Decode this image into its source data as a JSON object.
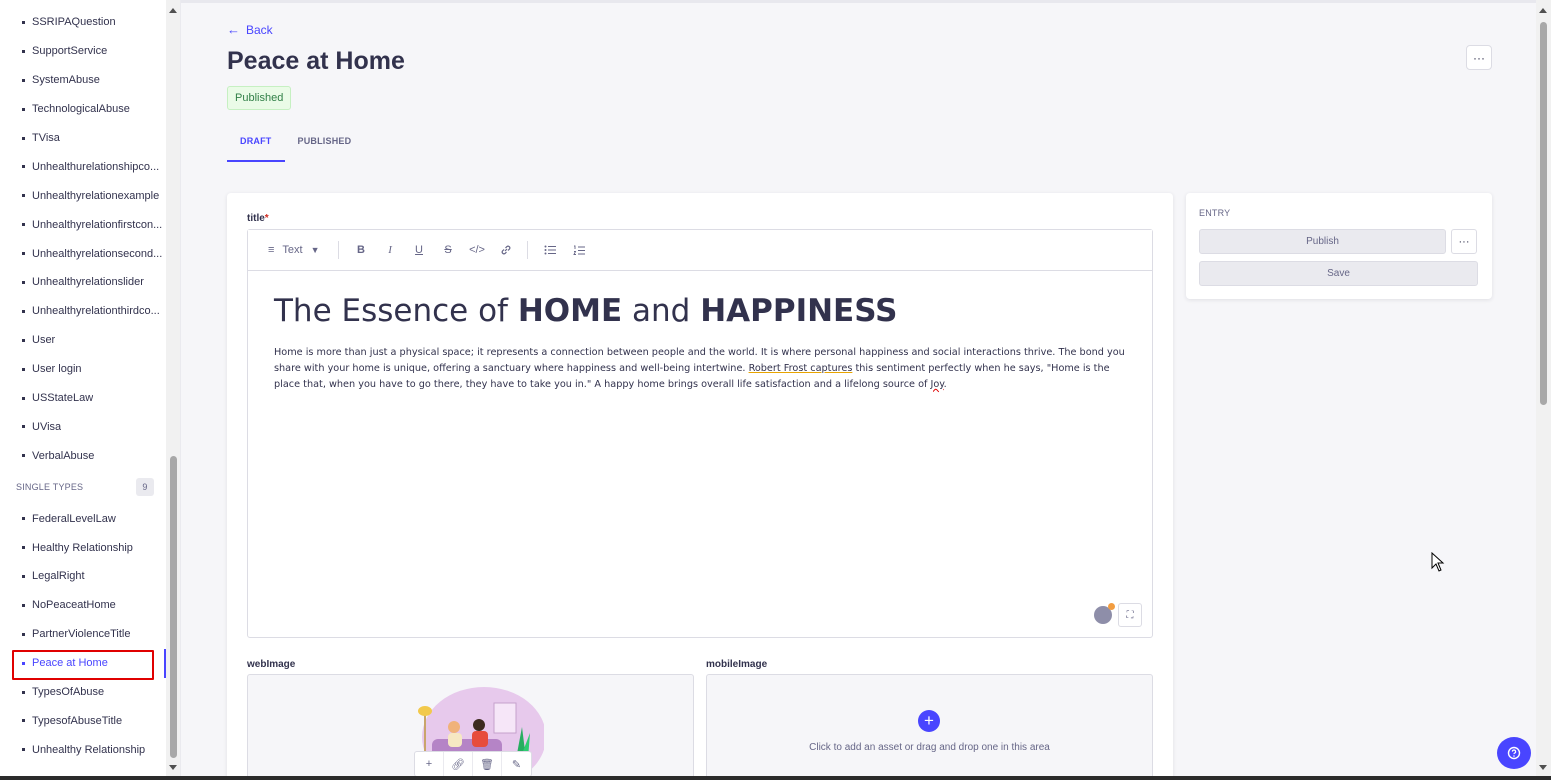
{
  "sidebar": {
    "collection_items": [
      {
        "label": "SSRIPAQuestion"
      },
      {
        "label": "SupportService"
      },
      {
        "label": "SystemAbuse"
      },
      {
        "label": "TechnologicalAbuse"
      },
      {
        "label": "TVisa"
      },
      {
        "label": "Unhealthurelationshipco..."
      },
      {
        "label": "Unhealthyrelationexample"
      },
      {
        "label": "Unhealthyrelationfirstcon..."
      },
      {
        "label": "Unhealthyrelationsecond..."
      },
      {
        "label": "Unhealthyrelationslider"
      },
      {
        "label": "Unhealthyrelationthirdco..."
      },
      {
        "label": "User"
      },
      {
        "label": "User login"
      },
      {
        "label": "USStateLaw"
      },
      {
        "label": "UVisa"
      },
      {
        "label": "VerbalAbuse"
      }
    ],
    "single_types_label": "SINGLE TYPES",
    "single_types_count": "9",
    "single_items": [
      {
        "label": "FederalLevelLaw"
      },
      {
        "label": "Healthy Relationship"
      },
      {
        "label": "LegalRight"
      },
      {
        "label": "NoPeaceatHome"
      },
      {
        "label": "PartnerViolenceTitle"
      },
      {
        "label": "Peace at Home",
        "active": true
      },
      {
        "label": "TypesOfAbuse"
      },
      {
        "label": "TypesofAbuseTitle"
      },
      {
        "label": "Unhealthy Relationship"
      }
    ]
  },
  "header": {
    "back_label": "Back",
    "title": "Peace at Home",
    "status": "Published",
    "more": "···"
  },
  "tabs": [
    {
      "label": "DRAFT",
      "active": true
    },
    {
      "label": "PUBLISHED",
      "active": false
    }
  ],
  "form": {
    "title_label": "title",
    "required_mark": "*",
    "toolbar": {
      "block_type": "Text",
      "buttons": [
        "B",
        "I",
        "U",
        "S",
        "</>",
        "link",
        "bullet-list",
        "numbered-list"
      ]
    },
    "heading": {
      "part1": "The Essence of ",
      "bold1": "HOME",
      "part2": " and ",
      "bold2": "HAPPINESS"
    },
    "paragraph": {
      "text1": "Home is more than just a physical space; it represents a connection between people and the world. It is where personal happiness and social interactions thrive. The bond you share with your home is unique, offering a sanctuary where happiness and well-being intertwine. ",
      "underlined": "Robert Frost captures",
      "text2": " this sentiment perfectly when he says, \"Home is the place that, when you have to go there, they have to take you in.\" A happy home brings overall life satisfaction and a lifelong source of ",
      "misspelled": "Joy",
      "text3": "."
    },
    "web_image_label": "webImage",
    "mobile_image_label": "mobileImage",
    "mobile_image_hint": "Click to add an asset or drag and drop one in this area"
  },
  "entry_panel": {
    "label": "ENTRY",
    "publish": "Publish",
    "save": "Save",
    "more": "···"
  },
  "colors": {
    "accent": "#4945ff",
    "published_bg": "#eafbe7",
    "published_text": "#328048",
    "active_outline": "#e00000"
  }
}
